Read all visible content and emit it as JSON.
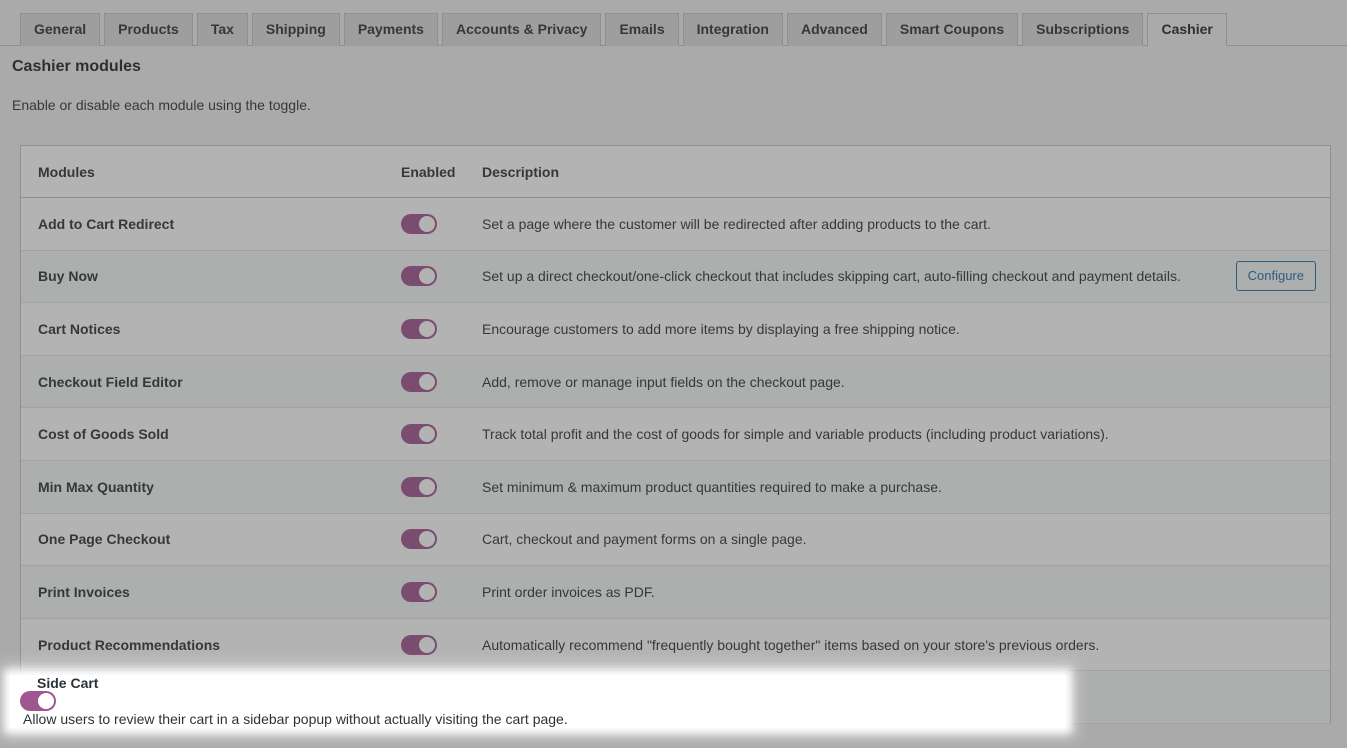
{
  "tabs": [
    {
      "label": "General",
      "active": false
    },
    {
      "label": "Products",
      "active": false
    },
    {
      "label": "Tax",
      "active": false
    },
    {
      "label": "Shipping",
      "active": false
    },
    {
      "label": "Payments",
      "active": false
    },
    {
      "label": "Accounts & Privacy",
      "active": false
    },
    {
      "label": "Emails",
      "active": false
    },
    {
      "label": "Integration",
      "active": false
    },
    {
      "label": "Advanced",
      "active": false
    },
    {
      "label": "Smart Coupons",
      "active": false
    },
    {
      "label": "Subscriptions",
      "active": false
    },
    {
      "label": "Cashier",
      "active": true
    }
  ],
  "header": {
    "title": "Cashier modules",
    "description": "Enable or disable each module using the toggle."
  },
  "table": {
    "columns": {
      "name": "Modules",
      "enabled": "Enabled",
      "description": "Description"
    },
    "rows": [
      {
        "name": "Add to Cart Redirect",
        "enabled": true,
        "description": "Set a page where the customer will be redirected after adding products to the cart.",
        "action": null
      },
      {
        "name": "Buy Now",
        "enabled": true,
        "description": "Set up a direct checkout/one-click checkout that includes skipping cart, auto-filling checkout and payment details.",
        "action": "Configure"
      },
      {
        "name": "Cart Notices",
        "enabled": true,
        "description": "Encourage customers to add more items by displaying a free shipping notice.",
        "action": null
      },
      {
        "name": "Checkout Field Editor",
        "enabled": true,
        "description": "Add, remove or manage input fields on the checkout page.",
        "action": null
      },
      {
        "name": "Cost of Goods Sold",
        "enabled": true,
        "description": "Track total profit and the cost of goods for simple and variable products (including product variations).",
        "action": null
      },
      {
        "name": "Min Max Quantity",
        "enabled": true,
        "description": "Set minimum & maximum product quantities required to make a purchase.",
        "action": null
      },
      {
        "name": "One Page Checkout",
        "enabled": true,
        "description": "Cart, checkout and payment forms on a single page.",
        "action": null
      },
      {
        "name": "Print Invoices",
        "enabled": true,
        "description": "Print order invoices as PDF.",
        "action": null
      },
      {
        "name": "Product Recommendations",
        "enabled": true,
        "description": "Automatically recommend \"frequently bought together\" items based on your store's previous orders.",
        "action": null
      },
      {
        "name": "Side Cart",
        "enabled": true,
        "description": "Allow users to review their cart in a sidebar popup without actually visiting the cart page.",
        "action": null
      }
    ]
  },
  "highlight": {
    "row_index": 9,
    "row_name": "Side Cart"
  },
  "colors": {
    "toggle_on": "#a0568f",
    "toggle_knob": "#ffffff",
    "link": "#2271b1",
    "text": "#2c3338",
    "page_bg": "#f0f0f1",
    "dim_overlay": "rgba(64,64,64,0.40)"
  }
}
